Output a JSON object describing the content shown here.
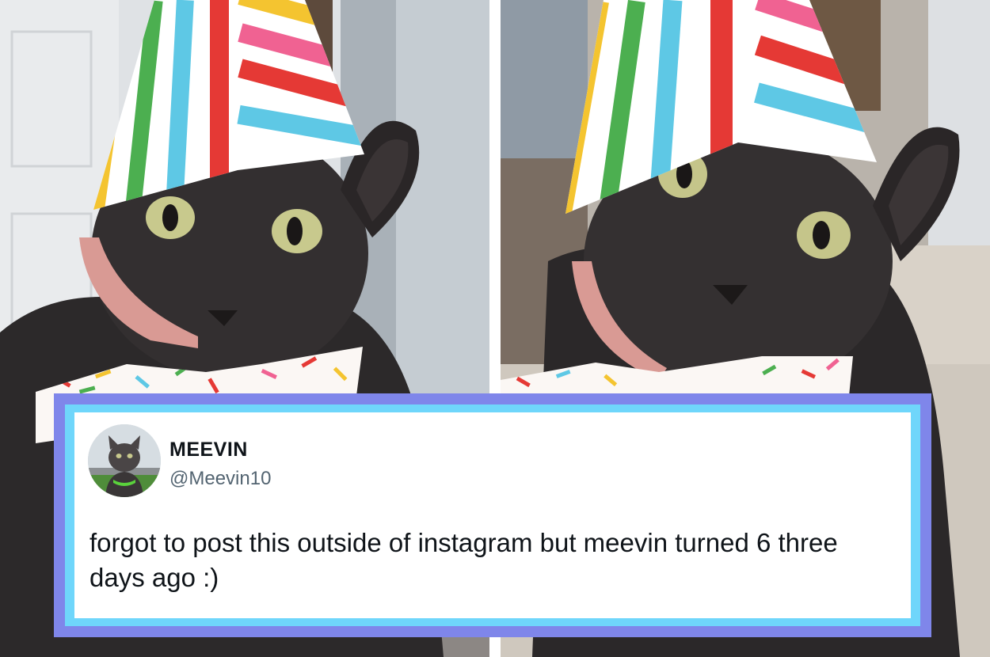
{
  "photos": [
    {
      "name": "cat-photo-left",
      "icon": "cat-party-hat-photo"
    },
    {
      "name": "cat-photo-right",
      "icon": "cat-party-hat-photo"
    }
  ],
  "tweet": {
    "avatar_icon": "cat-avatar",
    "display_name": "MEEVIN",
    "handle": "@Meevin10",
    "text": "forgot to post this outside of instagram but meevin turned 6 three days ago :)"
  },
  "colors": {
    "outer_frame": "#7f86ea",
    "inner_frame": "#6fd6fb",
    "card": "#ffffff",
    "name_text": "#0f1419",
    "handle_text": "#536471",
    "cat_fur": "#2f2b2c",
    "cat_eyes": "#c9c98a"
  }
}
